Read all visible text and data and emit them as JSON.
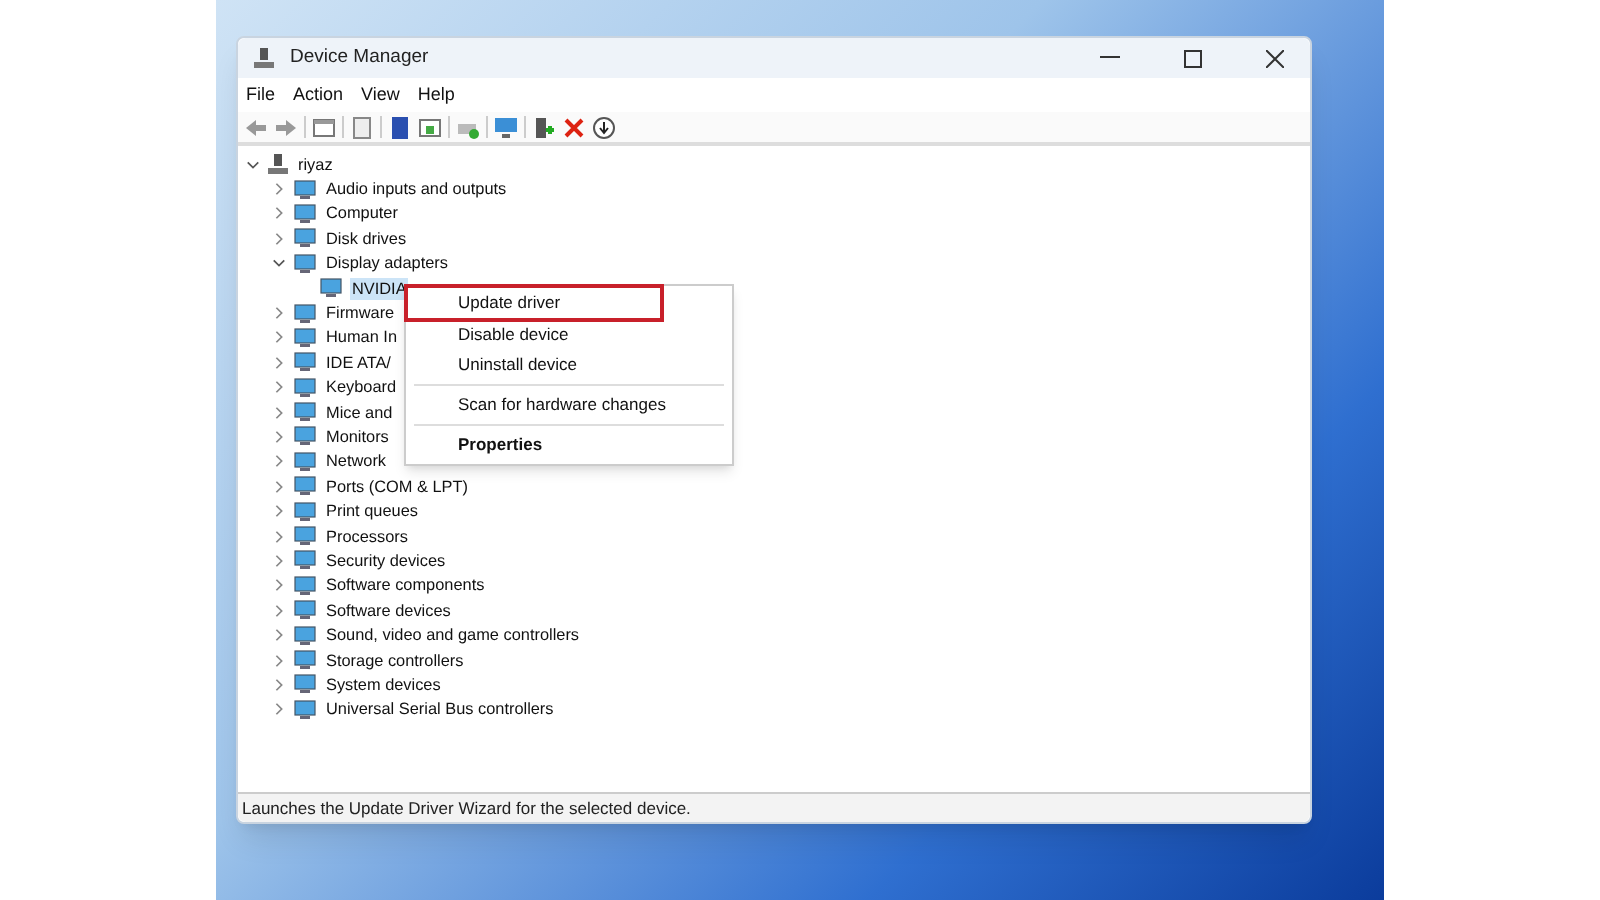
{
  "window": {
    "title": "Device Manager"
  },
  "menu_bar": [
    "File",
    "Action",
    "View",
    "Help"
  ],
  "tree": {
    "label": "riyaz",
    "expanded": true,
    "children": [
      {
        "label": "Audio inputs and outputs",
        "expanded": false
      },
      {
        "label": "Computer",
        "expanded": false
      },
      {
        "label": "Disk drives",
        "expanded": false
      },
      {
        "label": "Display adapters",
        "expanded": true,
        "children": [
          {
            "label": "NVIDIA",
            "selected": true
          }
        ]
      },
      {
        "label": "Firmware",
        "expanded": false
      },
      {
        "label": "Human In",
        "expanded": false
      },
      {
        "label": "IDE ATA/",
        "expanded": false
      },
      {
        "label": "Keyboard",
        "expanded": false
      },
      {
        "label": "Mice and",
        "expanded": false
      },
      {
        "label": "Monitors",
        "expanded": false
      },
      {
        "label": "Network",
        "expanded": false
      },
      {
        "label": "Ports (COM & LPT)",
        "expanded": false
      },
      {
        "label": "Print queues",
        "expanded": false
      },
      {
        "label": "Processors",
        "expanded": false
      },
      {
        "label": "Security devices",
        "expanded": false
      },
      {
        "label": "Software components",
        "expanded": false
      },
      {
        "label": "Software devices",
        "expanded": false
      },
      {
        "label": "Sound, video and game controllers",
        "expanded": false
      },
      {
        "label": "Storage controllers",
        "expanded": false
      },
      {
        "label": "System devices",
        "expanded": false
      },
      {
        "label": "Universal Serial Bus controllers",
        "expanded": false
      }
    ]
  },
  "context_menu": [
    {
      "kind": "item",
      "label": "Update driver",
      "selected": true
    },
    {
      "kind": "item",
      "label": "Disable device",
      "selected": false
    },
    {
      "kind": "item",
      "label": "Uninstall device",
      "selected": false
    },
    {
      "kind": "separator"
    },
    {
      "kind": "item",
      "label": "Scan for hardware changes",
      "selected": false
    },
    {
      "kind": "separator"
    },
    {
      "kind": "default",
      "label": "Properties",
      "selected": false
    }
  ],
  "status_bar": "Launches the Update Driver Wizard for the selected device."
}
